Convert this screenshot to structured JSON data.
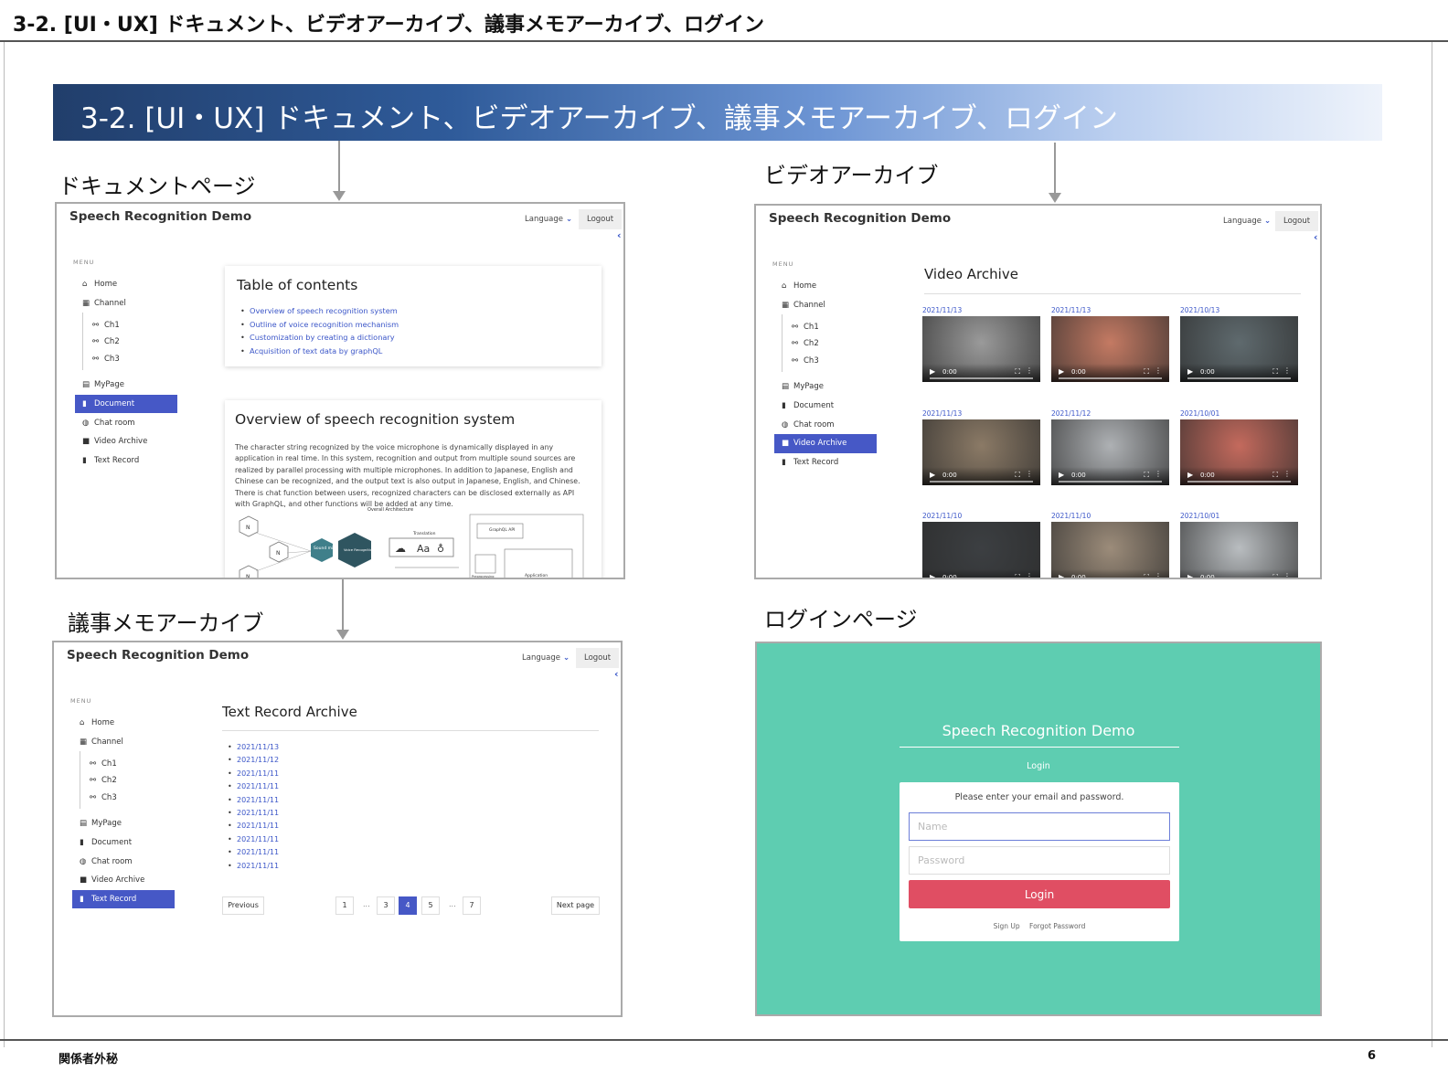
{
  "slide": {
    "header_title": "3-2. [UI・UX] ドキュメント、ビデオアーカイブ、議事メモアーカイブ、ログイン",
    "banner_title": "3-2. [UI・UX] ドキュメント、ビデオアーカイブ、議事メモアーカイブ、ログイン",
    "footer_left": "関係者外秘",
    "page_number": "6"
  },
  "sections": {
    "document": "ドキュメントページ",
    "video": "ビデオアーカイブ",
    "minutes": "議事メモアーカイブ",
    "login": "ログインページ"
  },
  "app": {
    "title": "Speech Recognition Demo",
    "language_label": "Language",
    "logout_label": "Logout",
    "menu_caption": "MENU",
    "menu": {
      "home": "Home",
      "channel": "Channel",
      "ch1": "Ch1",
      "ch2": "Ch2",
      "ch3": "Ch3",
      "mypage": "MyPage",
      "document": "Document",
      "chatroom": "Chat room",
      "video_archive": "Video Archive",
      "text_record": "Text Record"
    }
  },
  "document_page": {
    "toc_title": "Table of contents",
    "toc": [
      "Overview of speech recognition system",
      "Outline of voice recognition mechanism",
      "Customization by creating a dictionary",
      "Acquisition of text data by graphQL"
    ],
    "overview_title": "Overview of speech recognition system",
    "overview_text": "The character string recognized by the voice microphone is dynamically displayed in any application in real time. In this system, recognition and output from multiple sound sources are realized by parallel processing with multiple microphones. In addition to Japanese, English and Chinese can be recognized, and the output text is also output in Japanese, English, and Chinese. There is chat function between users, recognized characters can be disclosed externally as API with GraphQL, and other functions will be added at any time.",
    "diagram": {
      "title": "Overall Architecture",
      "node": "N",
      "sound": "Sound mic",
      "engine": "Voice Recognition Engine",
      "translation": "Translation",
      "aa": "Aa",
      "graphql": "GraphQL API",
      "preprocessing": "Preprocessing",
      "application": "Application"
    }
  },
  "video_page": {
    "title": "Video Archive",
    "time": "0:00",
    "videos": [
      {
        "date": "2021/11/13",
        "bg": "#9a9a9a"
      },
      {
        "date": "2021/11/13",
        "bg": "#c47a63"
      },
      {
        "date": "2021/10/13",
        "bg": "#5f6a6e"
      },
      {
        "date": "2021/11/13",
        "bg": "#8b7a66"
      },
      {
        "date": "2021/11/12",
        "bg": "#aeb1b4"
      },
      {
        "date": "2021/10/01",
        "bg": "#c46a5d"
      },
      {
        "date": "2021/11/10",
        "bg": "#3c3f42"
      },
      {
        "date": "2021/11/10",
        "bg": "#9c8c7a"
      },
      {
        "date": "2021/10/01",
        "bg": "#b9bdc0"
      }
    ]
  },
  "text_record_page": {
    "title": "Text Record Archive",
    "records": [
      "2021/11/13",
      "2021/11/12",
      "2021/11/11",
      "2021/11/11",
      "2021/11/11",
      "2021/11/11",
      "2021/11/11",
      "2021/11/11",
      "2021/11/11",
      "2021/11/11"
    ],
    "pagination": {
      "previous": "Previous",
      "next": "Next page",
      "pages": [
        "1",
        "3",
        "4",
        "5",
        "7"
      ],
      "dots": "...",
      "current": "4"
    }
  },
  "login_page": {
    "title": "Speech Recognition Demo",
    "subtitle": "Login",
    "message": "Please enter your email and password.",
    "name_placeholder": "Name",
    "password_placeholder": "Password",
    "button": "Login",
    "signup": "Sign Up",
    "forgot": "Forgot Password",
    "bg_color": "#5ecdb1",
    "button_color": "#e04e63"
  }
}
